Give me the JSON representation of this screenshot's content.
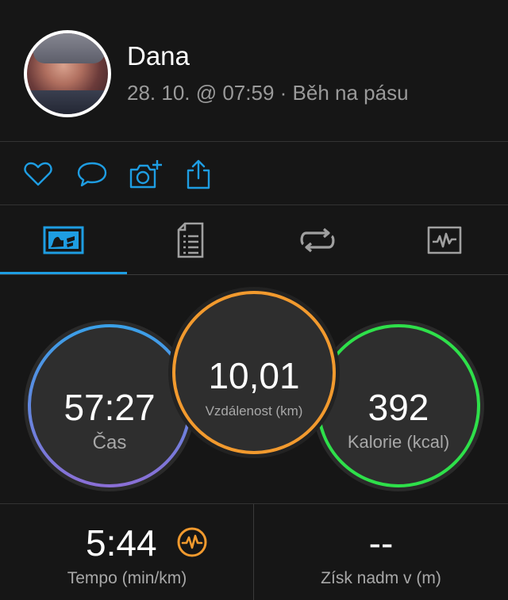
{
  "user": {
    "name": "Dana",
    "meta": "28. 10. @ 07:59 · Běh na pásu"
  },
  "actions": [
    {
      "icon": "heart-icon",
      "color": "#1e9de2"
    },
    {
      "icon": "comment-icon",
      "color": "#1e9de2"
    },
    {
      "icon": "add-photo-icon",
      "color": "#1e9de2"
    },
    {
      "icon": "share-icon",
      "color": "#1e9de2"
    }
  ],
  "tabs": [
    {
      "icon": "overview-tab-icon",
      "active": true
    },
    {
      "icon": "details-tab-icon",
      "active": false
    },
    {
      "icon": "laps-tab-icon",
      "active": false
    },
    {
      "icon": "chart-tab-icon",
      "active": false
    }
  ],
  "stats": {
    "time": {
      "value": "57:27",
      "label": "Čas"
    },
    "distance": {
      "value": "10,01",
      "label": "Vzdálenost (km)"
    },
    "calories": {
      "value": "392",
      "label": "Kalorie (kcal)"
    }
  },
  "bottom": {
    "pace": {
      "value": "5:44",
      "label": "Tempo (min/km)",
      "icon": "pace-badge-icon"
    },
    "elevation": {
      "value": "--",
      "label": "Získ nadm v (m)"
    }
  },
  "colors": {
    "accent": "#1e9de2",
    "distance_ring": "#f29a2e",
    "calories_ring": "#2ee04a",
    "time_ring_top": "#3aa0e8",
    "time_ring_bottom": "#8a6fd6"
  }
}
